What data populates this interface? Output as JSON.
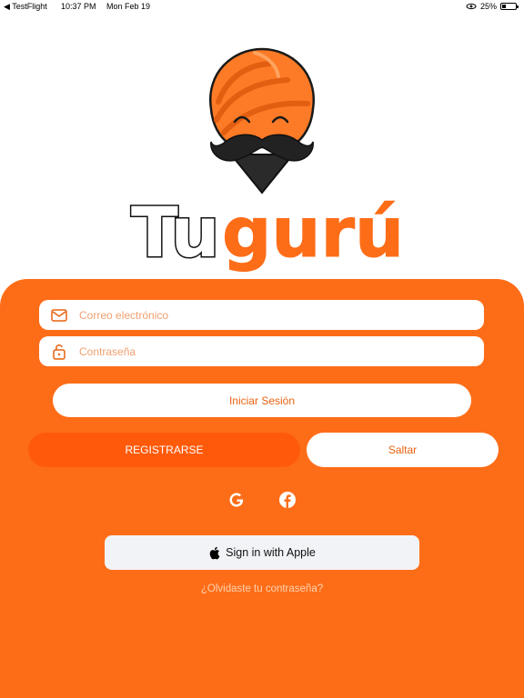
{
  "status_bar": {
    "back_app": "◀ TestFlight",
    "time": "10:37 PM",
    "date": "Mon Feb 19",
    "battery": "25%"
  },
  "brand": {
    "part1": "Tu",
    "part2": "gurú",
    "accent_color": "#FD6D18"
  },
  "login": {
    "email_placeholder": "Correo electrónico",
    "password_placeholder": "Contraseña",
    "login_label": "Iniciar Sesión",
    "register_label": "REGISTRARSE",
    "skip_label": "Saltar",
    "apple_label": "Sign in with Apple",
    "forgot_label": "¿Olvidaste tu contraseña?"
  },
  "icons": [
    "mail-icon",
    "lock-icon",
    "google-icon",
    "facebook-icon",
    "apple-icon"
  ]
}
